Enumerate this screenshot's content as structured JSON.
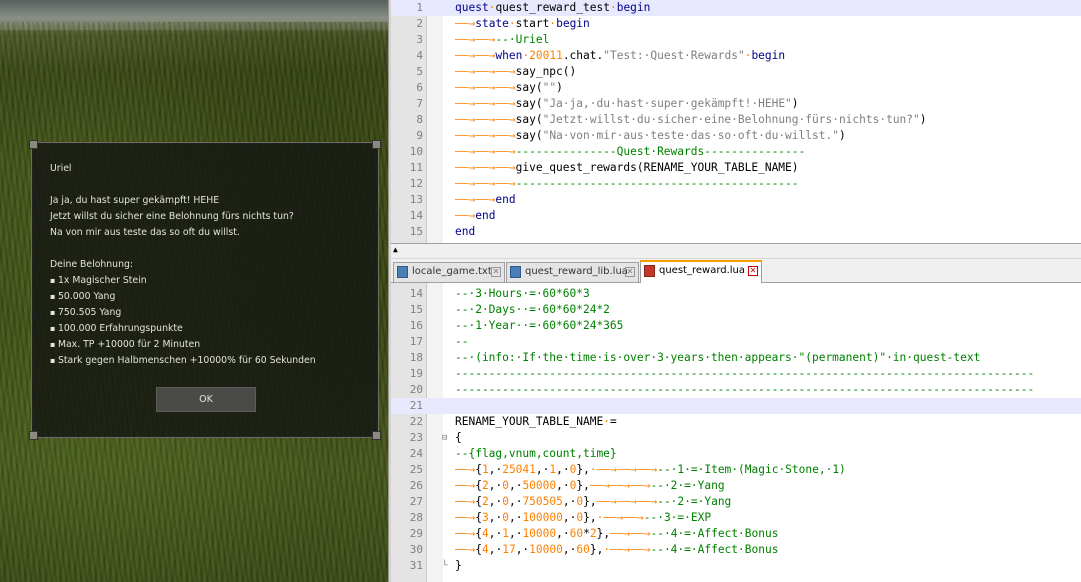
{
  "game": {
    "dialog": {
      "npc_name": "Uriel",
      "lines": [
        "Ja ja, du hast super gekämpft! HEHE",
        "Jetzt willst du sicher eine Belohnung fürs nichts tun?",
        "Na von mir aus teste das so oft du willst."
      ],
      "rewards_heading": "Deine Belohnung:",
      "rewards": [
        "1x Magischer Stein",
        "50.000 Yang",
        "750.505 Yang",
        "100.000 Erfahrungspunkte",
        "Max. TP +10000 für 2 Minuten",
        "Stark gegen Halbmenschen +10000% für 60 Sekunden"
      ],
      "ok_label": "OK"
    }
  },
  "editor": {
    "tabs": [
      {
        "label": "locale_game.txt",
        "active": false
      },
      {
        "label": "quest_reward_lib.lua",
        "active": false
      },
      {
        "label": "quest_reward.lua",
        "active": true
      }
    ],
    "top_lines": [
      {
        "n": "1",
        "hl": true,
        "parts": [
          [
            "kw",
            "quest"
          ],
          [
            "dot",
            "·"
          ],
          [
            "",
            "quest_reward_test"
          ],
          [
            "dot",
            "·"
          ],
          [
            "kw",
            "begin"
          ]
        ]
      },
      {
        "n": "2",
        "parts": [
          [
            "arw",
            "——→"
          ],
          [
            "kw",
            "state"
          ],
          [
            "dot",
            "·"
          ],
          [
            "",
            "start"
          ],
          [
            "dot",
            "·"
          ],
          [
            "kw",
            "begin"
          ]
        ]
      },
      {
        "n": "3",
        "parts": [
          [
            "arw",
            "——→——→"
          ],
          [
            "cm",
            "--·Uriel"
          ]
        ]
      },
      {
        "n": "4",
        "parts": [
          [
            "arw",
            "——→——→"
          ],
          [
            "kw",
            "when"
          ],
          [
            "dot",
            "·"
          ],
          [
            "num",
            "20011"
          ],
          [
            "",
            ".chat."
          ],
          [
            "str",
            "\"Test:·Quest·Rewards\""
          ],
          [
            "dot",
            "·"
          ],
          [
            "kw",
            "begin"
          ]
        ]
      },
      {
        "n": "5",
        "parts": [
          [
            "arw",
            "——→——→——→"
          ],
          [
            "",
            "say_npc()"
          ]
        ]
      },
      {
        "n": "6",
        "parts": [
          [
            "arw",
            "——→——→——→"
          ],
          [
            "",
            "say("
          ],
          [
            "str",
            "\"\""
          ],
          [
            "",
            ")"
          ]
        ]
      },
      {
        "n": "7",
        "parts": [
          [
            "arw",
            "——→——→——→"
          ],
          [
            "",
            "say("
          ],
          [
            "str",
            "\"Ja·ja,·du·hast·super·gekämpft!·HEHE\""
          ],
          [
            "",
            ")"
          ]
        ]
      },
      {
        "n": "8",
        "parts": [
          [
            "arw",
            "——→——→——→"
          ],
          [
            "",
            "say("
          ],
          [
            "str",
            "\"Jetzt·willst·du·sicher·eine·Belohnung·fürs·nichts·tun?\""
          ],
          [
            "",
            ")"
          ]
        ]
      },
      {
        "n": "9",
        "parts": [
          [
            "arw",
            "——→——→——→"
          ],
          [
            "",
            "say("
          ],
          [
            "str",
            "\"Na·von·mir·aus·teste·das·so·oft·du·willst.\""
          ],
          [
            "",
            ")"
          ]
        ]
      },
      {
        "n": "10",
        "parts": [
          [
            "arw",
            "——→——→——→"
          ],
          [
            "cm",
            "---------------Quest·Rewards---------------"
          ]
        ]
      },
      {
        "n": "11",
        "parts": [
          [
            "arw",
            "——→——→——→"
          ],
          [
            "",
            "give_quest_rewards(RENAME_YOUR_TABLE_NAME)"
          ]
        ]
      },
      {
        "n": "12",
        "parts": [
          [
            "arw",
            "——→——→——→"
          ],
          [
            "cm",
            "------------------------------------------"
          ]
        ]
      },
      {
        "n": "13",
        "parts": [
          [
            "arw",
            "——→——→"
          ],
          [
            "kw",
            "end"
          ]
        ]
      },
      {
        "n": "14",
        "parts": [
          [
            "arw",
            "——→"
          ],
          [
            "kw",
            "end"
          ]
        ]
      },
      {
        "n": "15",
        "parts": [
          [
            "kw",
            "end"
          ]
        ]
      }
    ],
    "bottom_lines": [
      {
        "n": "14",
        "parts": [
          [
            "cm",
            "--·3·Hours·=·60*60*3"
          ]
        ]
      },
      {
        "n": "15",
        "parts": [
          [
            "cm",
            "--·2·Days··=·60*60*24*2"
          ]
        ]
      },
      {
        "n": "16",
        "parts": [
          [
            "cm",
            "--·1·Year··=·60*60*24*365"
          ]
        ]
      },
      {
        "n": "17",
        "parts": [
          [
            "cm",
            "--"
          ]
        ]
      },
      {
        "n": "18",
        "parts": [
          [
            "cm",
            "--·(info:·If·the·time·is·over·3·years·then·appears·\"(permanent)\"·in·quest-text"
          ]
        ]
      },
      {
        "n": "19",
        "parts": [
          [
            "cm",
            "--------------------------------------------------------------------------------------"
          ]
        ]
      },
      {
        "n": "20",
        "parts": [
          [
            "cm",
            "--------------------------------------------------------------------------------------"
          ]
        ]
      },
      {
        "n": "21",
        "hl": true,
        "parts": []
      },
      {
        "n": "22",
        "parts": [
          [
            "",
            "RENAME_YOUR_TABLE_NAME"
          ],
          [
            "dot",
            "·"
          ],
          [
            "",
            "="
          ]
        ]
      },
      {
        "n": "23",
        "fold": "⊟",
        "parts": [
          [
            "",
            "{"
          ]
        ]
      },
      {
        "n": "24",
        "parts": [
          [
            "cm",
            "--{flag,vnum,count,time}"
          ]
        ]
      },
      {
        "n": "25",
        "parts": [
          [
            "arw",
            "——→"
          ],
          [
            "",
            "{"
          ],
          [
            "num",
            "1"
          ],
          [
            "",
            ",·"
          ],
          [
            "num",
            "25041"
          ],
          [
            "",
            ",·"
          ],
          [
            "num",
            "1"
          ],
          [
            "",
            ",·"
          ],
          [
            "num",
            "0"
          ],
          [
            "",
            "},"
          ],
          [
            "arw",
            "·——→——→——→"
          ],
          [
            "cm",
            "--·1·=·Item·(Magic·Stone,·1)"
          ]
        ]
      },
      {
        "n": "26",
        "parts": [
          [
            "arw",
            "——→"
          ],
          [
            "",
            "{"
          ],
          [
            "num",
            "2"
          ],
          [
            "",
            ",·"
          ],
          [
            "num",
            "0"
          ],
          [
            "",
            ",·"
          ],
          [
            "num",
            "50000"
          ],
          [
            "",
            ",·"
          ],
          [
            "num",
            "0"
          ],
          [
            "",
            "},"
          ],
          [
            "arw",
            "——→——→——→"
          ],
          [
            "cm",
            "--·2·=·Yang"
          ]
        ]
      },
      {
        "n": "27",
        "parts": [
          [
            "arw",
            "——→"
          ],
          [
            "",
            "{"
          ],
          [
            "num",
            "2"
          ],
          [
            "",
            ",·"
          ],
          [
            "num",
            "0"
          ],
          [
            "",
            ",·"
          ],
          [
            "num",
            "750505"
          ],
          [
            "",
            ",·"
          ],
          [
            "num",
            "0"
          ],
          [
            "",
            "},"
          ],
          [
            "arw",
            "——→——→——→"
          ],
          [
            "cm",
            "--·2·=·Yang"
          ]
        ]
      },
      {
        "n": "28",
        "parts": [
          [
            "arw",
            "——→"
          ],
          [
            "",
            "{"
          ],
          [
            "num",
            "3"
          ],
          [
            "",
            ",·"
          ],
          [
            "num",
            "0"
          ],
          [
            "",
            ",·"
          ],
          [
            "num",
            "100000"
          ],
          [
            "",
            ",·"
          ],
          [
            "num",
            "0"
          ],
          [
            "",
            "},"
          ],
          [
            "arw",
            "·——→——→"
          ],
          [
            "cm",
            "--·3·=·EXP"
          ]
        ]
      },
      {
        "n": "29",
        "parts": [
          [
            "arw",
            "——→"
          ],
          [
            "",
            "{"
          ],
          [
            "num",
            "4"
          ],
          [
            "",
            ",·"
          ],
          [
            "num",
            "1"
          ],
          [
            "",
            ",·"
          ],
          [
            "num",
            "10000"
          ],
          [
            "",
            ",·"
          ],
          [
            "num",
            "60"
          ],
          [
            "",
            "*"
          ],
          [
            "num",
            "2"
          ],
          [
            "",
            "},"
          ],
          [
            "arw",
            "——→——→"
          ],
          [
            "cm",
            "--·4·=·Affect·Bonus"
          ]
        ]
      },
      {
        "n": "30",
        "parts": [
          [
            "arw",
            "——→"
          ],
          [
            "",
            "{"
          ],
          [
            "num",
            "4"
          ],
          [
            "",
            ",·"
          ],
          [
            "num",
            "17"
          ],
          [
            "",
            ",·"
          ],
          [
            "num",
            "10000"
          ],
          [
            "",
            ",·"
          ],
          [
            "num",
            "60"
          ],
          [
            "",
            "},"
          ],
          [
            "arw",
            "·——→——→"
          ],
          [
            "cm",
            "--·4·=·Affect·Bonus"
          ]
        ]
      },
      {
        "n": "31",
        "fold": "└",
        "parts": [
          [
            "",
            "}"
          ]
        ]
      }
    ]
  }
}
